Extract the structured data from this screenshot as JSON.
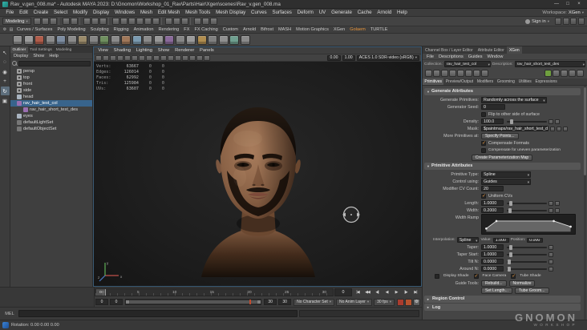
{
  "window": {
    "title": "Rav_v.gen_008.ma* - Autodesk MAYA 2023: D:\\Gnomon\\Workshop_01_Rav\\Parts\\Hair\\Xgen\\scenes\\Rav_v.gen_008.ma"
  },
  "menubar": {
    "items": [
      "File",
      "Edit",
      "Create",
      "Select",
      "Modify",
      "Display",
      "Windows",
      "Mesh",
      "Edit Mesh",
      "Mesh Tools",
      "Mesh Display",
      "Curves",
      "Surfaces",
      "Deform",
      "UV",
      "Generate",
      "Cache",
      "Arnold",
      "Help"
    ],
    "workspace_label": "Workspace:",
    "workspace_value": "XGen"
  },
  "statusline": {
    "mode_selector": "Modeling",
    "sign_in_label": "Sign in"
  },
  "shelf": {
    "tabs": [
      "Curves / Surfaces",
      "Poly Modeling",
      "Sculpting",
      "Rigging",
      "Animation",
      "Rendering",
      "FX",
      "FX Caching",
      "Custom",
      "Arnold",
      "Bifrost",
      "MASH",
      "Motion Graphics",
      "XGen",
      "Golaem",
      "TURTLE"
    ],
    "active_tab": "Golaem"
  },
  "outliner": {
    "tabs": [
      "Outliner",
      "Tool Settings",
      "Modeling"
    ],
    "active_tab": "Outliner",
    "menus": [
      "Display",
      "Show",
      "Help"
    ],
    "items": [
      {
        "label": "persp",
        "icon": "camera",
        "depth": 0
      },
      {
        "label": "top",
        "icon": "camera",
        "depth": 0
      },
      {
        "label": "front",
        "icon": "camera",
        "depth": 0
      },
      {
        "label": "side",
        "icon": "camera",
        "depth": 0
      },
      {
        "label": "head",
        "icon": "mesh",
        "depth": 0
      },
      {
        "label": "rav_hair_test_col",
        "icon": "xgen",
        "depth": 0,
        "selected": true
      },
      {
        "label": "rav_hair_short_test_des",
        "icon": "xgen",
        "depth": 1
      },
      {
        "label": "eyes",
        "icon": "mesh",
        "depth": 0
      },
      {
        "label": "defaultLightSet",
        "icon": "set",
        "depth": 0
      },
      {
        "label": "defaultObjectSet",
        "icon": "set",
        "depth": 0
      }
    ]
  },
  "viewport": {
    "menus": [
      "View",
      "Shading",
      "Lighting",
      "Show",
      "Renderer",
      "Panels"
    ],
    "exposure": "0.00",
    "gamma": "1.00",
    "colorspace": "ACES 1.0 SDR-video (sRGB)",
    "hud": [
      {
        "label": "Verts:",
        "value": "63667",
        "c1": "0",
        "c2": "0"
      },
      {
        "label": "Edges:",
        "value": "126014",
        "c1": "0",
        "c2": "0"
      },
      {
        "label": "Faces:",
        "value": "62992",
        "c1": "0",
        "c2": "0"
      },
      {
        "label": "Tris:",
        "value": "125984",
        "c1": "0",
        "c2": "0"
      },
      {
        "label": "UVs:",
        "value": "63607",
        "c1": "0",
        "c2": "0"
      }
    ]
  },
  "timeline": {
    "labels": [
      "0",
      "5",
      "10",
      "15",
      "20",
      "25",
      "30"
    ],
    "current_frame": "0"
  },
  "range": {
    "start_outer": "0",
    "start_inner": "0",
    "end_inner": "30",
    "end_outer": "30",
    "character_set": "No Character Set",
    "anim_layer": "No Anim Layer",
    "fps": "30 fps"
  },
  "command_line": {
    "label": "MEL"
  },
  "helpline": {
    "text": "Rotation: 0.00 0.00 0.00"
  },
  "watermark": {
    "line1": "GNOMON",
    "line2": "WORKSHOP"
  },
  "xgen": {
    "panel_tabs": [
      "Channel Box / Layer Editor",
      "Attribute Editor",
      "XGen"
    ],
    "active_tab": "XGen",
    "menus": [
      "File",
      "Descriptions",
      "Guides",
      "Window"
    ],
    "collection_label": "Collection:",
    "collection_value": "rav_hair_test_col",
    "description_label": "Description:",
    "description_value": "rav_hair_short_test_des",
    "tabs": [
      "Primitives",
      "Preview/Output",
      "Modifiers",
      "Grooming",
      "Utilities",
      "Expressions"
    ],
    "active_subtab": "Primitives",
    "generate": {
      "title": "Generate Attributes",
      "rows": {
        "generate_primitives": {
          "label": "Generate Primitives:",
          "value": "Randomly across the surface"
        },
        "generator_seed": {
          "label": "Generator Seed:",
          "value": "0"
        },
        "flip": {
          "label": "Flip to other side of surface",
          "checked": false
        },
        "density": {
          "label": "Density:",
          "value": "100.0"
        },
        "mask": {
          "label": "Mask:",
          "value": "$paintmaps/rav_hair_short_test_des"
        },
        "more_primitives": {
          "label": "More Primitives at:",
          "button": "Specify Points..."
        },
        "compensate_formats": {
          "label": "Compensate Formats",
          "checked": true
        },
        "compensate_uneven": {
          "label": "Compensate for uneven parameterization",
          "checked": false
        },
        "create_param_map": {
          "button": "Create Parameterization Map"
        }
      }
    },
    "primitive": {
      "title": "Primitive Attributes",
      "primitive_type": {
        "label": "Primitive Type:",
        "value": "Spline"
      },
      "control_using": {
        "label": "Control using:",
        "value": "Guides"
      },
      "modifier_cv": {
        "label": "Modifier CV Count:",
        "value": "20"
      },
      "uniform_cvs": {
        "label": "Uniform CVs",
        "checked": true
      },
      "length": {
        "label": "Length:",
        "value": "1.0000"
      },
      "width": {
        "label": "Width:",
        "value": "0.2000"
      },
      "width_ramp_label": "Width Ramp",
      "width_ramp_points": [
        [
          0,
          0.25
        ],
        [
          0.12,
          0.85
        ],
        [
          0.8,
          0.85
        ],
        [
          1,
          0.4
        ]
      ],
      "ramp": {
        "interpolation_label": "Interpolation:",
        "interpolation_value": "Spline",
        "value_label": "Value:",
        "value": "1.000",
        "position_label": "Position:",
        "position": "0.000"
      },
      "taper": {
        "label": "Taper:",
        "value": "1.0000"
      },
      "taper_start": {
        "label": "Taper Start:",
        "value": "1.0000"
      },
      "tilt_n": {
        "label": "Tilt N:",
        "value": "0.0000"
      },
      "around_n": {
        "label": "Around N:",
        "value": "0.0000"
      },
      "display_shade": {
        "label": "Display Shade",
        "checked": false
      },
      "face_camera": {
        "label": "Face Camera",
        "checked": true
      },
      "tube_shade": {
        "label": "Tube Shade",
        "checked": true
      },
      "guide_tools_label": "Guide Tools:",
      "guide_buttons": [
        "Rebuild...",
        "Normalize",
        "Set Length...",
        "Tube Groom..."
      ]
    },
    "collapsed_sections": [
      "Region Control",
      "Log"
    ]
  },
  "icons": {
    "window_buttons": [
      {
        "n": "minimize-button",
        "g": "—"
      },
      {
        "n": "maximize-button",
        "g": "□"
      },
      {
        "n": "close-button",
        "g": "×"
      }
    ],
    "statusline": [
      {
        "n": "new-scene-icon"
      },
      {
        "n": "open-scene-icon"
      },
      {
        "n": "save-scene-icon"
      },
      {
        "sep": true
      },
      {
        "n": "undo-icon"
      },
      {
        "n": "redo-icon"
      },
      {
        "sep": true
      },
      {
        "n": "select-by-hierarchy-icon"
      },
      {
        "n": "select-by-object-type-icon"
      },
      {
        "n": "select-by-component-type-icon"
      },
      {
        "sep": true
      },
      {
        "n": "snap-to-grid-icon"
      },
      {
        "n": "snap-to-curve-icon"
      },
      {
        "n": "snap-to-point-icon"
      },
      {
        "n": "snap-to-projected-center-icon"
      },
      {
        "n": "snap-to-view-plane-icon"
      },
      {
        "n": "make-live-icon"
      },
      {
        "sep": true
      },
      {
        "n": "input-operations-icon"
      },
      {
        "n": "output-operations-icon"
      },
      {
        "n": "construction-history-icon"
      },
      {
        "sep": true
      },
      {
        "n": "render-frame-icon"
      },
      {
        "n": "ipr-render-icon"
      },
      {
        "n": "render-settings-icon"
      }
    ],
    "panel_toggles": [
      {
        "n": "toggle-channel-box-icon"
      },
      {
        "n": "toggle-attribute-editor-icon"
      },
      {
        "n": "toggle-tool-settings-icon"
      },
      {
        "n": "toggle-modeling-toolkit-icon"
      }
    ],
    "shelf_leading": [
      {
        "n": "shelf-menu-icon",
        "g": "⚙"
      },
      {
        "n": "shelf-tabs-icon",
        "g": "▤"
      }
    ],
    "shelf": [
      {
        "n": "shelf-icon-01",
        "c": "#8d8d8d"
      },
      {
        "n": "shelf-icon-02",
        "c": "#9b9b9b"
      },
      {
        "n": "shelf-icon-03",
        "c": "#b05c4a"
      },
      {
        "n": "shelf-icon-04",
        "c": "#8a8a8a"
      },
      {
        "n": "shelf-icon-05",
        "c": "#7d8ca0"
      },
      {
        "n": "shelf-icon-06",
        "c": "#8a8a8a"
      },
      {
        "n": "shelf-icon-07",
        "c": "#9a8a6a"
      },
      {
        "n": "shelf-icon-08",
        "c": "#858585"
      },
      {
        "n": "shelf-icon-09",
        "c": "#6f8f5f"
      },
      {
        "n": "shelf-icon-10",
        "c": "#8a8a8a"
      },
      {
        "n": "shelf-icon-11",
        "c": "#a0785a"
      },
      {
        "n": "shelf-icon-12",
        "c": "#7a9ab0"
      },
      {
        "n": "shelf-icon-13",
        "c": "#8a8a8a"
      },
      {
        "n": "shelf-icon-14",
        "c": "#979797"
      },
      {
        "n": "shelf-icon-15",
        "c": "#8a6a9a"
      },
      {
        "n": "shelf-icon-16",
        "c": "#858585"
      },
      {
        "n": "shelf-icon-17",
        "c": "#9a9a9a"
      },
      {
        "n": "shelf-icon-18",
        "c": "#b08d4f"
      },
      {
        "n": "shelf-icon-19",
        "c": "#808080"
      },
      {
        "n": "shelf-icon-20",
        "c": "#8f8f8f"
      },
      {
        "n": "shelf-icon-21",
        "c": "#6f9f8f"
      },
      {
        "n": "shelf-icon-22",
        "c": "#8a8a8a"
      }
    ],
    "toolbox": [
      {
        "n": "select-tool",
        "g": "↖"
      },
      {
        "n": "lasso-select-tool",
        "g": "◌"
      },
      {
        "n": "paint-select-tool",
        "g": "◉"
      },
      {
        "n": "move-tool",
        "g": "+"
      },
      {
        "n": "rotate-tool",
        "g": "↻",
        "active": true
      },
      {
        "n": "scale-tool",
        "g": "▣"
      }
    ],
    "layout_buttons": [
      {
        "n": "single-pane-layout-button",
        "g": "▢"
      },
      {
        "n": "four-pane-layout-button",
        "g": "⊞"
      },
      {
        "n": "persp-outliner-layout-button",
        "g": "◫"
      },
      {
        "n": "split-pane-layout-button",
        "g": "◧"
      }
    ],
    "vp_toolbar": [
      {
        "n": "select-camera-icon"
      },
      {
        "n": "lock-camera-icon"
      },
      {
        "n": "camera-attributes-icon"
      },
      {
        "n": "bookmark-icon"
      },
      {
        "n": "image-plane-icon"
      },
      {
        "n": "2d-pan-zoom-icon"
      },
      {
        "n": "grease-pencil-icon"
      },
      {
        "n": "wireframe-shading-icon"
      },
      {
        "n": "smooth-shading-icon"
      },
      {
        "n": "textured-shading-icon"
      },
      {
        "n": "use-all-lights-icon"
      },
      {
        "n": "shadows-icon"
      },
      {
        "n": "screen-space-ao-icon"
      },
      {
        "n": "motion-blur-icon"
      },
      {
        "n": "isolate-select-icon"
      },
      {
        "n": "grid-display-icon"
      }
    ],
    "xgen_tools_left": [
      {
        "n": "xgen-description-menu-icon"
      },
      {
        "n": "xgen-create-description-icon"
      },
      {
        "n": "xgen-create-collection-icon"
      },
      {
        "n": "xgen-add-guide-icon"
      },
      {
        "n": "xgen-move-guide-icon"
      },
      {
        "n": "xgen-sculpt-guide-icon"
      },
      {
        "n": "xgen-guide-visibility-icon"
      },
      {
        "n": "xgen-export-patches-icon"
      }
    ],
    "xgen_tools_right": [
      {
        "n": "xgen-update-preview-icon",
        "c": "#6f9f3f"
      },
      {
        "n": "xgen-auto-update-icon"
      },
      {
        "n": "xgen-clear-preview-icon"
      },
      {
        "n": "xgen-refresh-icon"
      },
      {
        "n": "xgen-panel-options-icon"
      }
    ],
    "playback": [
      {
        "n": "go-to-start-button",
        "g": "|◀"
      },
      {
        "n": "step-back-key-button",
        "g": "◀◀"
      },
      {
        "n": "step-back-frame-button",
        "g": "◀|"
      },
      {
        "n": "play-backwards-button",
        "g": "◀"
      },
      {
        "n": "play-forwards-button",
        "g": "▶"
      },
      {
        "n": "step-forward-frame-button",
        "g": "|▶"
      },
      {
        "n": "go-to-end-button",
        "g": "▶|"
      }
    ],
    "range_icons": [
      {
        "n": "set-key-icon",
        "c": "#a93c2e"
      },
      {
        "n": "auto-key-icon",
        "c": "#b5522e"
      },
      {
        "n": "anim-preferences-icon",
        "g": "⚙"
      }
    ]
  },
  "colors": {
    "accent_orange": "#e8953a",
    "selection_blue": "#38648c"
  }
}
